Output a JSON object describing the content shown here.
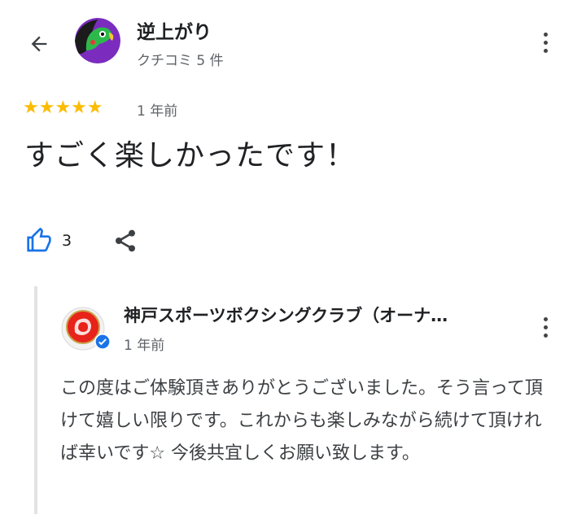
{
  "header": {
    "back_icon": "arrow-left-icon",
    "reviewer_name": "逆上がり",
    "reviewer_review_count": "クチコミ 5 件",
    "more_icon": "more-vertical-icon"
  },
  "review": {
    "rating": 5,
    "stars_text": "★★★★★",
    "date": "1 年前",
    "text": "すごく楽しかったです！",
    "like_count": "3",
    "like_icon": "thumbs-up-icon",
    "share_icon": "share-icon"
  },
  "owner_reply": {
    "name": "神戸スポーツボクシングクラブ（オーナ…",
    "date": "1 年前",
    "verified_icon": "verified-check-icon",
    "text": "この度はご体験頂きありがとうございました。そう言って頂けて嬉しい限りです。これからも楽しみながら続けて頂ければ幸いです☆ 今後共宜しくお願い致します。"
  },
  "colors": {
    "star": "#fbbc04",
    "like_blue": "#1a73e8",
    "text_primary": "#202124",
    "text_secondary": "#5f6368"
  }
}
